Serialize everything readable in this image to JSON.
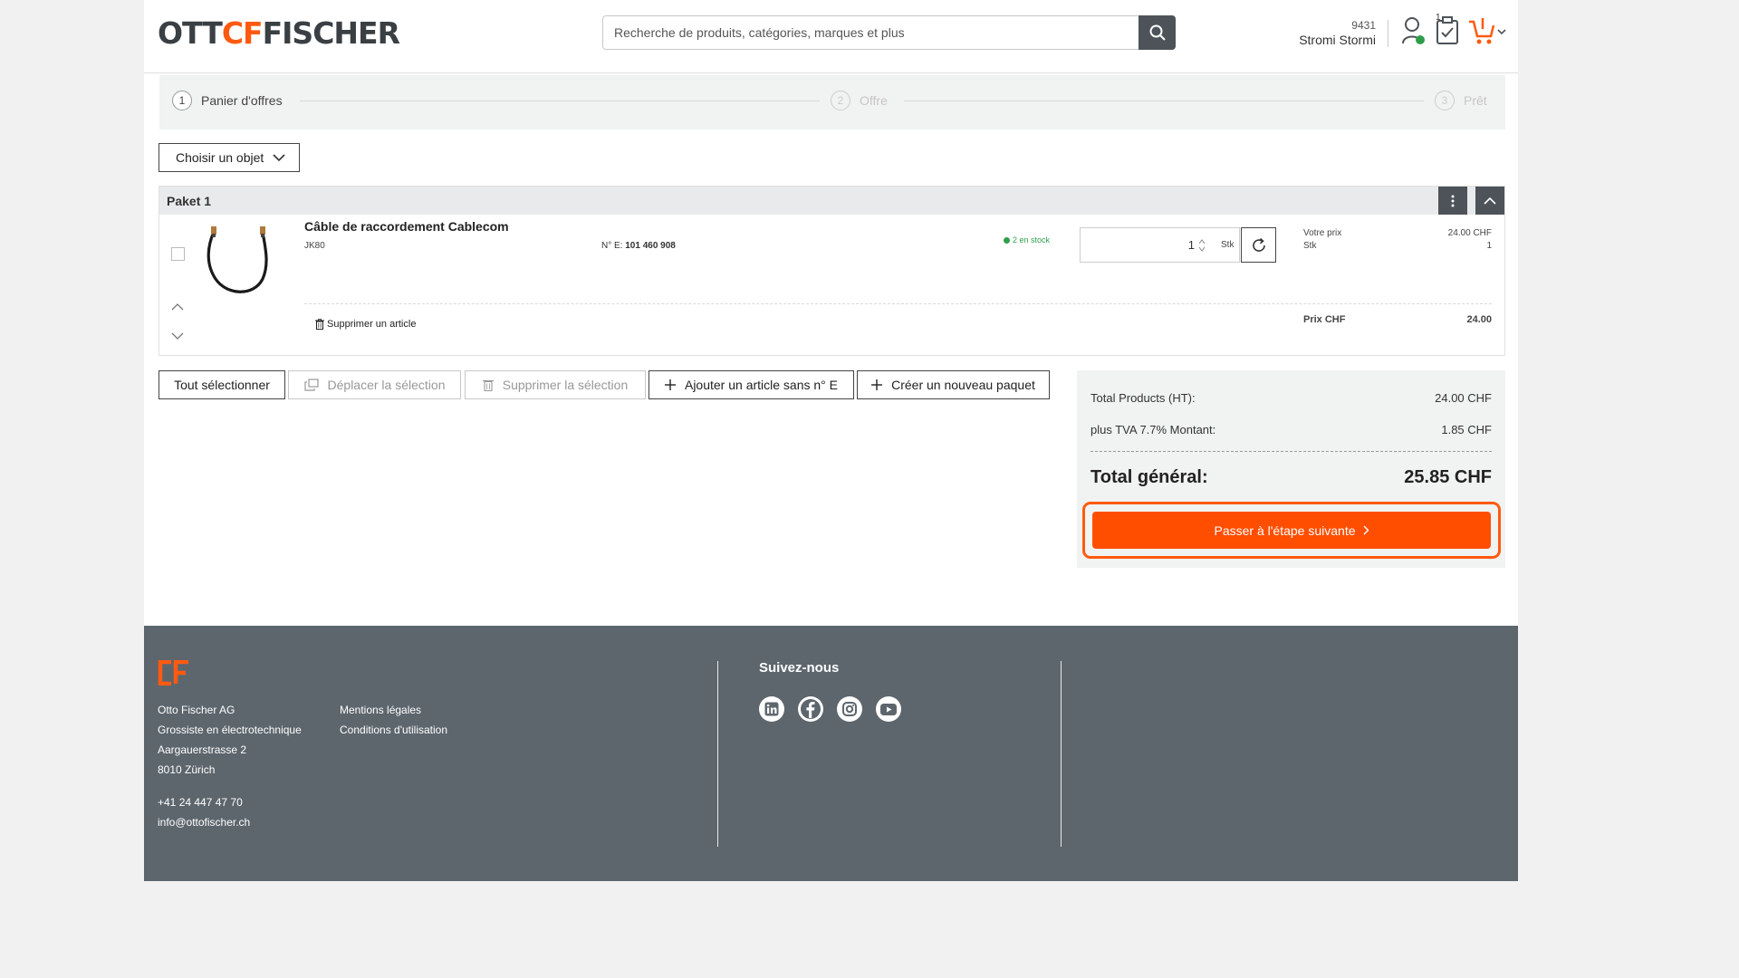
{
  "header": {
    "logo_left": "OTT",
    "logo_mid": "CF",
    "logo_right": "FISCHER",
    "search_placeholder": "Recherche de produits, catégories, marques et plus",
    "user_number": "9431",
    "user_name": "Stromi Stormi",
    "cart_badge": "1"
  },
  "steps": [
    {
      "num": "1",
      "label": "Panier d'offres"
    },
    {
      "num": "2",
      "label": "Offre"
    },
    {
      "num": "3",
      "label": "Prêt"
    }
  ],
  "object_select": "Choisir un objet",
  "package": {
    "title": "Paket 1",
    "item": {
      "name": "Câble de raccordement Cablecom",
      "code": "JK80",
      "enum_label": "N° E:",
      "enum_value": "101 460 908",
      "stock": "2 en stock",
      "qty": "1",
      "unit": "Stk",
      "price_label": "Votre prix",
      "price_value": "24.00 CHF",
      "unit_label": "Stk",
      "unit_value": "1",
      "delete_label": "Supprimer un article",
      "total_label": "Prix CHF",
      "total_value": "24.00"
    }
  },
  "actions": {
    "select_all": "Tout sélectionner",
    "move": "Déplacer la sélection",
    "delete": "Supprimer la sélection",
    "add_no_e": "Ajouter un article sans n° E",
    "new_package": "Créer un nouveau paquet"
  },
  "totals": {
    "products_label": "Total Products (HT):",
    "products_value": "24.00 CHF",
    "vat_label": "plus TVA 7.7% Montant:",
    "vat_value": "1.85 CHF",
    "grand_label": "Total général:",
    "grand_value": "25.85 CHF",
    "next_label": "Passer à l'étape suivante"
  },
  "footer": {
    "address": [
      "Otto Fischer AG",
      "Grossiste en électrotechnique",
      "Aargauerstrasse 2",
      "8010 Zürich"
    ],
    "phone": "+41 24 447 47 70",
    "email": "info@ottofischer.ch",
    "links": [
      "Mentions légales",
      "Conditions d'utilisation"
    ],
    "follow_title": "Suivez-nous"
  },
  "colors": {
    "accent": "#ff5a10",
    "dark": "#4d5359",
    "footer": "#5d666d",
    "stock_green": "#2e9e4a"
  }
}
